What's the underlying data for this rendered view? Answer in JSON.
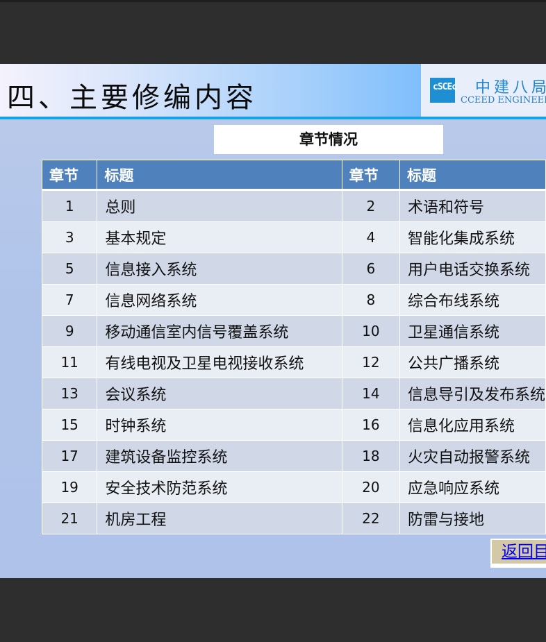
{
  "header": {
    "title": "四、主要修编内容",
    "logo_mark": "cSCEc",
    "logo_cn": "中建八局",
    "logo_en": "CCEED ENGINEERI"
  },
  "subtitle": "章节情况",
  "table": {
    "headers": [
      "章节",
      "标题",
      "章节",
      "标题"
    ],
    "rows": [
      [
        "1",
        "总则",
        "2",
        "术语和符号"
      ],
      [
        "3",
        "基本规定",
        "4",
        "智能化集成系统"
      ],
      [
        "5",
        "信息接入系统",
        "6",
        "用户电话交换系统"
      ],
      [
        "7",
        "信息网络系统",
        "8",
        "综合布线系统"
      ],
      [
        "9",
        "移动通信室内信号覆盖系统",
        "10",
        "卫星通信系统"
      ],
      [
        "11",
        "有线电视及卫星电视接收系统",
        "12",
        "公共广播系统"
      ],
      [
        "13",
        "会议系统",
        "14",
        "信息导引及发布系统"
      ],
      [
        "15",
        "时钟系统",
        "16",
        "信息化应用系统"
      ],
      [
        "17",
        "建筑设备监控系统",
        "18",
        "火灾自动报警系统"
      ],
      [
        "19",
        "安全技术防范系统",
        "20",
        "应急响应系统"
      ],
      [
        "21",
        "机房工程",
        "22",
        "防雷与接地"
      ]
    ]
  },
  "back_link": "返回目录",
  "colors": {
    "header_blue": "#4f81bd",
    "row_odd": "#d0d8e8",
    "row_even": "#e9edf4",
    "accent_line": "#14a3e4"
  }
}
